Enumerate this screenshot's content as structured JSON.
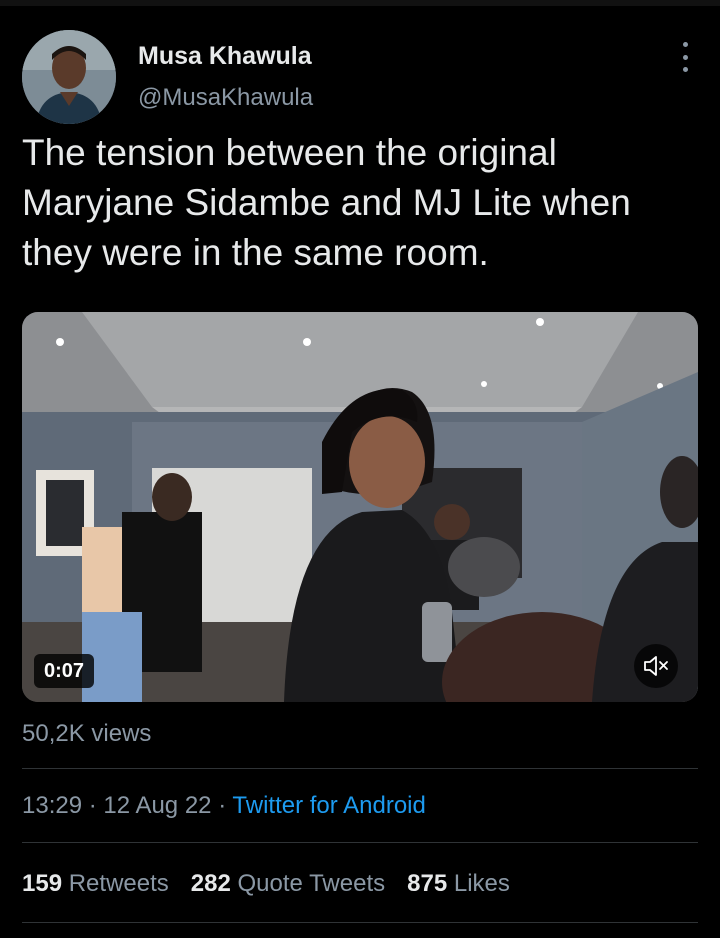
{
  "author": {
    "display_name": "Musa Khawula",
    "handle": "@MusaKhawula"
  },
  "tweet": {
    "lines": [
      "The tension between the original",
      "Maryjane Sidambe and MJ Lite when",
      "they were in the same room."
    ]
  },
  "video": {
    "timer": "0:07",
    "mute_icon": "speaker-muted-icon"
  },
  "views": "50,2K views",
  "meta": {
    "time": "13:29",
    "date": "12 Aug 22",
    "separator": "·",
    "source": "Twitter for Android"
  },
  "stats": {
    "retweets_count": "159",
    "retweets_label": "Retweets",
    "quotes_count": "282",
    "quotes_label": "Quote Tweets",
    "likes_count": "875",
    "likes_label": "Likes"
  },
  "colors": {
    "background": "#000000",
    "text": "#e7e9ea",
    "secondary": "#8b98a5",
    "link": "#1d9bf0",
    "divider": "#2f3336"
  }
}
